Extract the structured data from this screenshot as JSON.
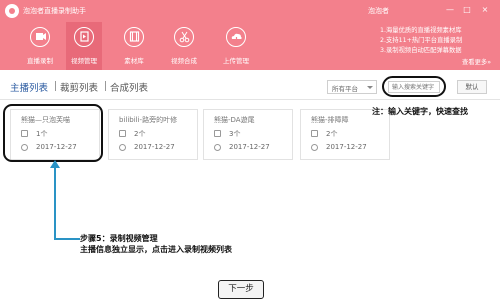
{
  "app": {
    "title": "泡泡者直播录制助手",
    "user": "泡泡者",
    "window_controls": [
      "—",
      "□",
      "×"
    ]
  },
  "nav": [
    {
      "label": "直播录制",
      "icon": "video-camera-icon",
      "active": false
    },
    {
      "label": "视频管理",
      "icon": "video-file-icon",
      "active": true
    },
    {
      "label": "素材库",
      "icon": "film-icon",
      "active": false
    },
    {
      "label": "视频合成",
      "icon": "scissors-icon",
      "active": false
    },
    {
      "label": "上传管理",
      "icon": "cloud-upload-icon",
      "active": false
    }
  ],
  "promo": {
    "lines": [
      "1.海量优质的直播视频素材库",
      "2.支持11+热门平台直播录制",
      "3.录制视频自动匹配弹幕数据"
    ],
    "more": "查看更多»"
  },
  "tabs": [
    "主播列表",
    "裁剪列表",
    "合成列表"
  ],
  "filter": {
    "platform": "所有平台",
    "search_placeholder": "输入搜索关键字",
    "default_label": "默认"
  },
  "cards": [
    {
      "name": "熊猫—只泡芙喵",
      "count": "1个",
      "date": "2017-12-27"
    },
    {
      "name": "bilibili-路旁的叶修",
      "count": "2个",
      "date": "2017-12-27"
    },
    {
      "name": "熊猫-DA遊尾",
      "count": "3个",
      "date": "2017-12-27"
    },
    {
      "name": "熊猫-排障障",
      "count": "2个",
      "date": "2017-12-27"
    }
  ],
  "annotations": {
    "search_note": "注：输入关键字，快速查找",
    "step_line1": "步骤5：录制视频管理",
    "step_line2": "主播信息独立显示，点击进入录制视频列表"
  },
  "colors": {
    "header": "#f3808c",
    "active_nav": "#e86a79",
    "active_tab": "#2a5aa0",
    "arrow": "#2a93c5"
  },
  "next_button": "下一步"
}
